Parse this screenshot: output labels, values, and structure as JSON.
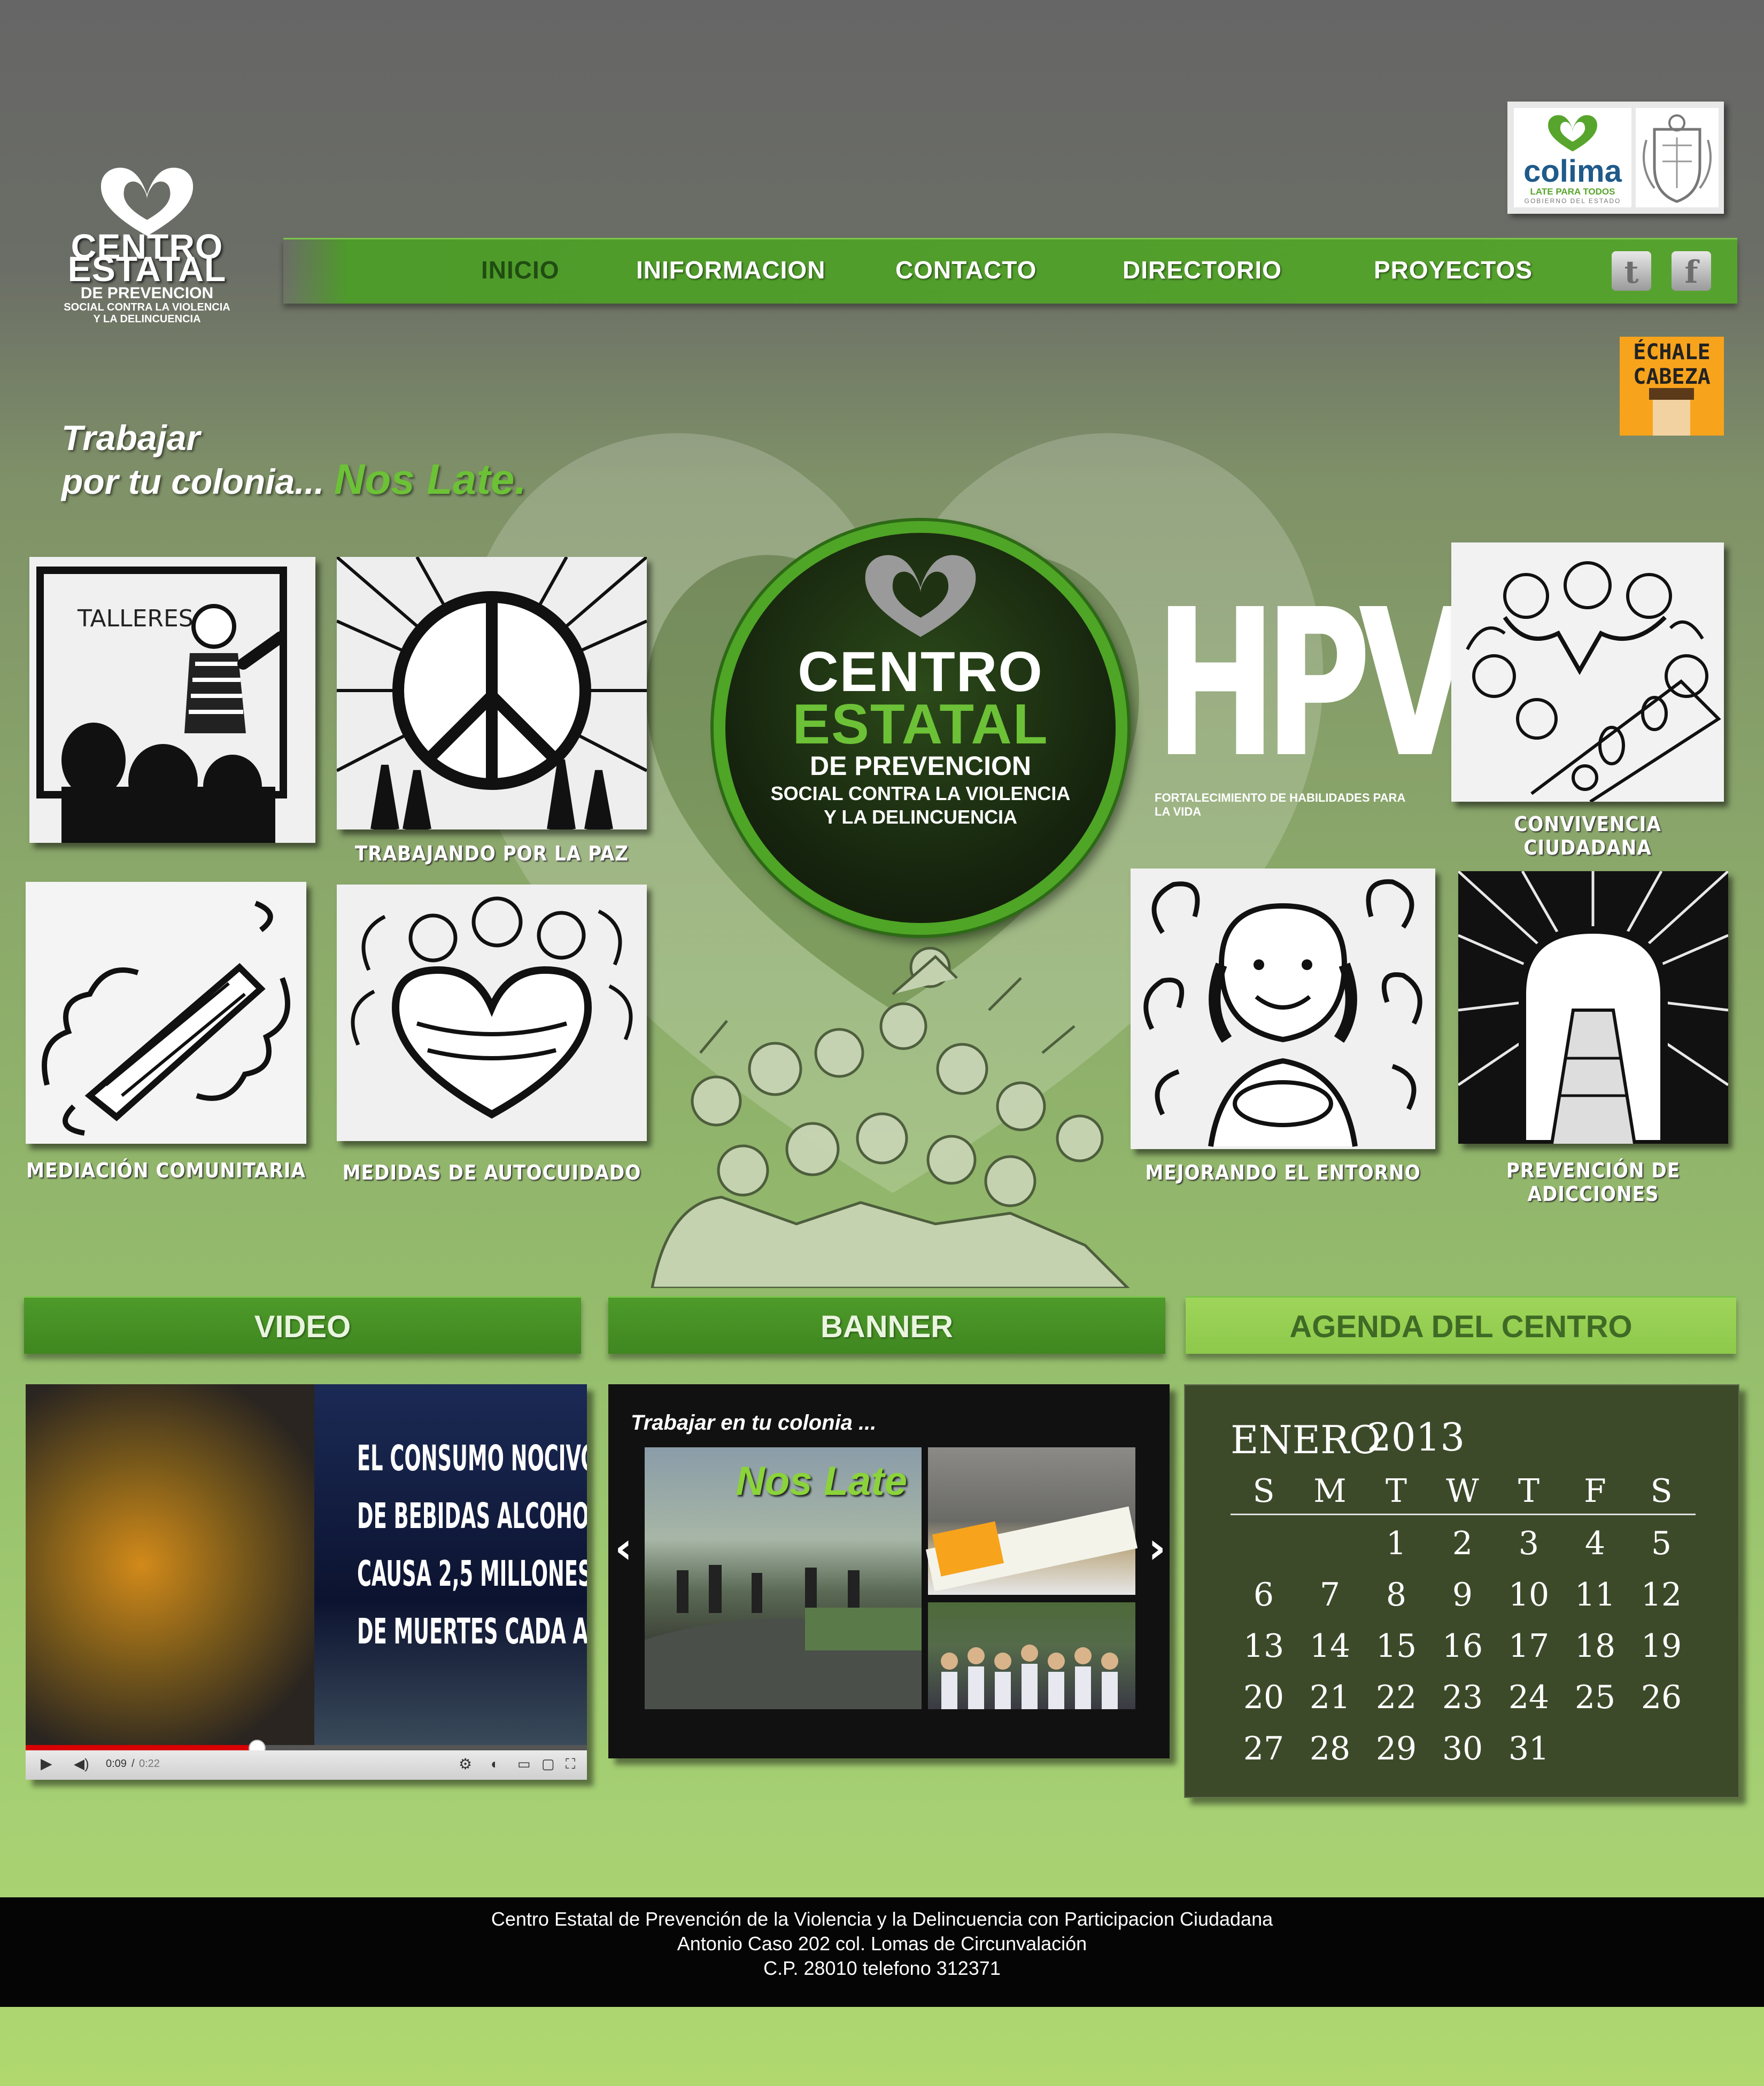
{
  "logo": {
    "line1": "CENTRO",
    "line2": "ESTATAL",
    "line3": "DE PREVENCION",
    "line4": "SOCIAL CONTRA LA VIOLENCIA",
    "line5": "Y LA DELINCUENCIA"
  },
  "colima_badge": {
    "name": "colima",
    "tagline": "LATE PARA TODOS",
    "sub": "GOBIERNO DEL ESTADO"
  },
  "nav": {
    "items": [
      "INICIO",
      "INIFORMACION",
      "CONTACTO",
      "DIRECTORIO",
      "PROYECTOS"
    ],
    "active": "INICIO"
  },
  "social": {
    "twitter": "t",
    "facebook": "f"
  },
  "echale": {
    "line1": "ÉCHALE",
    "line2": "CABEZA"
  },
  "tagline": {
    "line1": "Trabajar",
    "line2": "por tu colonia...",
    "highlight": "Nos Late."
  },
  "emblem": {
    "line1": "CENTRO",
    "line2": "ESTATAL",
    "line3": "DE PREVENCION",
    "line4": "SOCIAL CONTRA LA VIOLENCIA",
    "line5": "Y LA DELINCUENCIA"
  },
  "hpv": {
    "title": "HPV",
    "subtitle": "FORTALECIMIENTO DE HABILIDADES PARA LA VIDA"
  },
  "programs": {
    "paz": "TRABAJANDO POR LA PAZ",
    "convivencia": "CONVIVENCIA CIUDADANA",
    "mediacion": "MEDIACIÓN COMUNITARIA",
    "autocuidado": "MEDIDAS DE AUTOCUIDADO",
    "entorno": "MEJORANDO EL ENTORNO",
    "adicciones": "PREVENCIÓN DE ADICCIONES",
    "talleres_board": "TALLERES"
  },
  "sections": {
    "video": "VIDEO",
    "banner": "BANNER",
    "agenda": "AGENDA DEL CENTRO"
  },
  "video": {
    "lines": [
      "EL CONSUMO NOCIVO",
      "DE BEBIDAS ALCOHOLICAS",
      "CAUSA 2,5 MILLONES",
      "DE MUERTES CADA AÑO"
    ],
    "time_current": "0:09",
    "time_total": "0:22",
    "progress": 0.41
  },
  "banner": {
    "caption": "Trabajar en tu colonia ...",
    "overlay": "Nos Late",
    "prev": "‹",
    "next": "›"
  },
  "calendar": {
    "month": "ENERO",
    "year": "2013",
    "weekdays": [
      "S",
      "M",
      "T",
      "W",
      "T",
      "F",
      "S"
    ],
    "weeks": [
      [
        "",
        "",
        "1",
        "2",
        "3",
        "4",
        "5"
      ],
      [
        "6",
        "7",
        "8",
        "9",
        "10",
        "11",
        "12"
      ],
      [
        "13",
        "14",
        "15",
        "16",
        "17",
        "18",
        "19"
      ],
      [
        "20",
        "21",
        "22",
        "23",
        "24",
        "25",
        "26"
      ],
      [
        "27",
        "28",
        "29",
        "30",
        "31",
        "",
        ""
      ]
    ]
  },
  "footer": {
    "line1": "Centro Estatal de Prevención de la Violencia y la Delincuencia con Participacion Ciudadana",
    "line2": "Antonio Caso 202 col. Lomas de Circunvalación",
    "line3": "C.P. 28010 telefono 312371"
  },
  "colors": {
    "accent_green": "#56a22e",
    "light_green": "#6cc137",
    "calendar_bg": "#3d4a2a",
    "footer_bg": "#050505"
  }
}
